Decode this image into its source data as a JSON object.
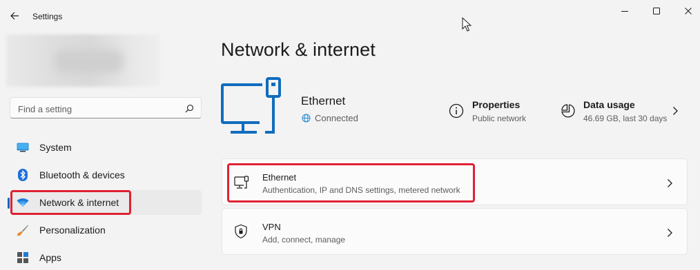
{
  "window": {
    "app_title": "Settings"
  },
  "search": {
    "placeholder": "Find a setting"
  },
  "sidebar": {
    "items": [
      {
        "label": "System",
        "icon": "monitor-icon"
      },
      {
        "label": "Bluetooth & devices",
        "icon": "bluetooth-icon"
      },
      {
        "label": "Network & internet",
        "icon": "wifi-icon",
        "selected": true
      },
      {
        "label": "Personalization",
        "icon": "paintbrush-icon"
      },
      {
        "label": "Apps",
        "icon": "apps-icon"
      }
    ]
  },
  "main": {
    "page_title": "Network & internet",
    "connection": {
      "name": "Ethernet",
      "status": "Connected"
    },
    "properties": {
      "title": "Properties",
      "subtitle": "Public network"
    },
    "data_usage": {
      "title": "Data usage",
      "subtitle": "46.69 GB, last 30 days"
    },
    "cards": [
      {
        "title": "Ethernet",
        "subtitle": "Authentication, IP and DNS settings, metered network",
        "icon": "ethernet-icon"
      },
      {
        "title": "VPN",
        "subtitle": "Add, connect, manage",
        "icon": "shield-icon"
      }
    ]
  },
  "colors": {
    "accent": "#0067c0",
    "highlight_box": "#e02032",
    "background": "#f3f3f3"
  }
}
